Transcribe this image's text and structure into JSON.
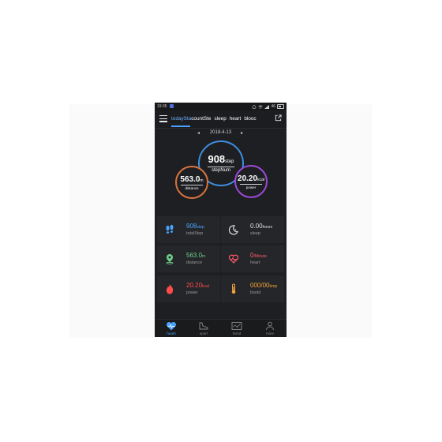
{
  "status_bar": {
    "time": "19:35",
    "right_text": "46"
  },
  "nav": {
    "tabs": [
      {
        "label": "todaySta",
        "active": true
      },
      {
        "label": "countSte",
        "active": false
      },
      {
        "label": "sleep",
        "active": false
      },
      {
        "label": "heart",
        "active": false
      },
      {
        "label": "blooc",
        "active": false
      }
    ]
  },
  "date_row": {
    "date": "2018-4-13",
    "prev": "◂",
    "next": "▸"
  },
  "circles": {
    "steps": {
      "value": "908",
      "unit": "step",
      "label": "stepNum",
      "color": "#3d8fe0"
    },
    "distance": {
      "value": "563.0",
      "unit": "m",
      "label": "distance",
      "color": "#d8743f"
    },
    "power": {
      "value": "20.20",
      "unit": "kcal",
      "label": "power",
      "color": "#9a4ad6"
    }
  },
  "stats": [
    {
      "value": "908",
      "unit": "step",
      "label": "totalStep",
      "icon": "footsteps-icon",
      "color": "#4aa2ff"
    },
    {
      "value": "0.00",
      "unit": "hours",
      "label": "sleep",
      "icon": "moon-icon",
      "color": "#e0e0e0"
    },
    {
      "value": "563.0",
      "unit": "m",
      "label": "distance",
      "icon": "location-pin-icon",
      "color": "#6fd08a"
    },
    {
      "value": "0",
      "unit": "/Minute",
      "label": "heart",
      "icon": "heartbeat-icon",
      "color": "#ff5a6a"
    },
    {
      "value": "20.20",
      "unit": "kcal",
      "label": "power",
      "icon": "flame-icon",
      "color": "#ff4d4d"
    },
    {
      "value": "000/00",
      "unit": "bmp",
      "label": "boold",
      "icon": "thermometer-icon",
      "color": "#f2a23a"
    }
  ],
  "bottom_nav": [
    {
      "label": "heath",
      "icon": "heart-pulse-icon",
      "active": true
    },
    {
      "label": "sport",
      "icon": "shoe-icon",
      "active": false
    },
    {
      "label": "trend",
      "icon": "trend-icon",
      "active": false
    },
    {
      "label": "mine",
      "icon": "person-icon",
      "active": false
    }
  ]
}
